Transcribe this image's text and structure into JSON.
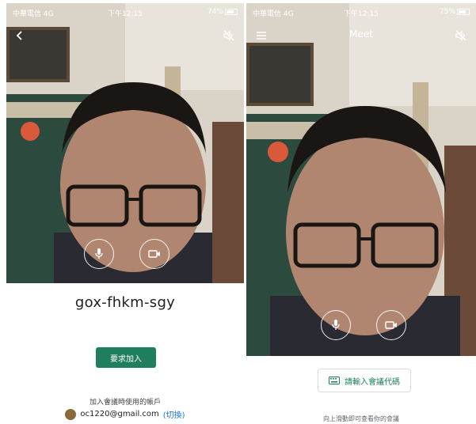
{
  "left_screen": {
    "status_bar": {
      "carrier": "中華電信 4G",
      "time": "下午12:15",
      "battery": "74%",
      "battery_level": 0.74
    },
    "back_icon": "chevron-left-icon",
    "speaker_icon": "speaker-off-icon",
    "mic_icon": "microphone-icon",
    "camera_icon": "video-camera-icon",
    "meeting_code": "gox-fhkm-sgy",
    "join_button": "要求加入",
    "account_label": "加入會議時使用的帳戶",
    "account_email": "oc1220@gmail.com",
    "switch_link": "(切換)",
    "accent_color": "#1e7e5e"
  },
  "right_screen": {
    "status_bar": {
      "carrier": "中華電信 4G",
      "time": "下午12:15",
      "battery": "75%",
      "battery_level": 0.75
    },
    "menu_icon": "hamburger-menu-icon",
    "title": "Meet",
    "speaker_icon": "speaker-off-icon",
    "mic_icon": "microphone-icon",
    "camera_icon": "video-camera-icon",
    "code_button": "請輸入會議代碼",
    "code_button_icon": "keyboard-icon",
    "swipe_hint": "向上滑動即可查看你的會議"
  }
}
